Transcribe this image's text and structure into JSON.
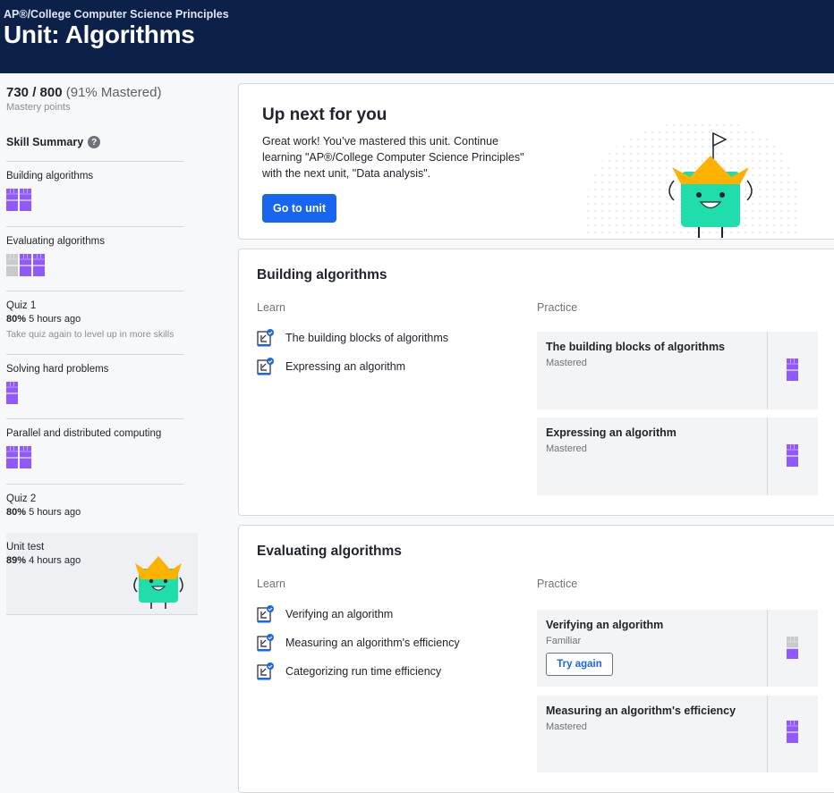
{
  "header": {
    "breadcrumb": "AP®/College Computer Science Principles",
    "title": "Unit: Algorithms"
  },
  "sidebar": {
    "score": "730 / 800",
    "score_pct": "(91% Mastered)",
    "score_sub": "Mastery points",
    "skill_summary": "Skill Summary",
    "items": [
      {
        "name": "Building algorithms",
        "levels": [
          "mastered",
          "mastered"
        ]
      },
      {
        "name": "Evaluating algorithms",
        "levels": [
          "not-started",
          "mastered",
          "mastered"
        ]
      },
      {
        "name": "Quiz 1",
        "score": "80%",
        "time": "5 hours ago",
        "hint": "Take quiz again to level up in more skills"
      },
      {
        "name": "Solving hard problems",
        "levels": [
          "mastered"
        ]
      },
      {
        "name": "Parallel and distributed computing",
        "levels": [
          "mastered",
          "mastered"
        ]
      },
      {
        "name": "Quiz 2",
        "score": "80%",
        "time": "5 hours ago"
      },
      {
        "name": "Unit test",
        "score": "89%",
        "time": "4 hours ago"
      }
    ]
  },
  "upnext": {
    "title": "Up next for you",
    "text": "Great work! You’ve mastered this unit. Continue learning \"AP®/College Computer Science Principles\" with the next unit, \"Data analysis\".",
    "button": "Go to unit"
  },
  "sections": [
    {
      "title": "Building algorithms",
      "learn_label": "Learn",
      "practice_label": "Practice",
      "learn": [
        "The building blocks of algorithms",
        "Expressing an algorithm"
      ],
      "practice": [
        {
          "title": "The building blocks of algorithms",
          "status": "Mastered",
          "mastery": 1
        },
        {
          "title": "Expressing an algorithm",
          "status": "Mastered",
          "mastery": 1
        }
      ]
    },
    {
      "title": "Evaluating algorithms",
      "learn_label": "Learn",
      "practice_label": "Practice",
      "learn": [
        "Verifying an algorithm",
        "Measuring an algorithm's efficiency",
        "Categorizing run time efficiency"
      ],
      "practice": [
        {
          "title": "Verifying an algorithm",
          "status": "Familiar",
          "mastery": 0.5,
          "button": "Try again"
        },
        {
          "title": "Measuring an algorithm's efficiency",
          "status": "Mastered",
          "mastery": 1
        }
      ]
    }
  ],
  "colors": {
    "header_bg": "#0b2149",
    "primary": "#1865f2",
    "mastered": "#9059ff",
    "mascot": "#1fdeac",
    "crown": "#ffb100"
  }
}
